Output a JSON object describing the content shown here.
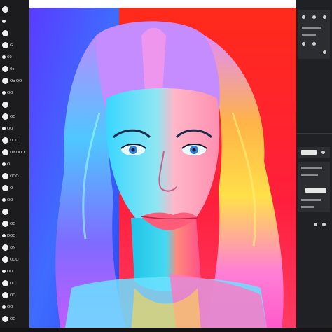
{
  "app": {
    "accent_color": "#f1f1f1",
    "toolbar_color": "#1c1c1e",
    "panel_color": "#202124"
  },
  "toolbar": {
    "tools": [
      {
        "icon": "brush-icon",
        "label": ""
      },
      {
        "icon": "eraser-icon",
        "label": ""
      },
      {
        "icon": "smudge-icon",
        "label": ""
      },
      {
        "icon": "blur-icon",
        "label": "G"
      },
      {
        "icon": "fill-icon",
        "label": "60"
      },
      {
        "icon": "select-icon",
        "label": "0o"
      },
      {
        "icon": "transform-icon",
        "label": "Oo OO"
      },
      {
        "icon": "text-icon",
        "label": "OO"
      },
      {
        "icon": "color-icon",
        "label": ""
      },
      {
        "icon": "layers-icon",
        "label": "OO"
      },
      {
        "icon": "adjust-icon",
        "label": "OO"
      },
      {
        "icon": "filter-icon",
        "label": "DOO"
      },
      {
        "icon": "shape-icon",
        "label": "De DOO"
      },
      {
        "icon": "gradient-icon",
        "label": "O"
      },
      {
        "icon": "pen-icon",
        "label": "OOO"
      },
      {
        "icon": "clone-icon",
        "label": "O"
      },
      {
        "icon": "heal-icon",
        "label": "OO"
      },
      {
        "icon": "liquify-icon",
        "label": ""
      },
      {
        "icon": "crop-icon",
        "label": "OO"
      },
      {
        "icon": "mask-icon",
        "label": "DOO"
      },
      {
        "icon": "warp-icon",
        "label": "ON"
      },
      {
        "icon": "mirror-icon",
        "label": "OOO"
      },
      {
        "icon": "grid-icon",
        "label": "OO"
      },
      {
        "icon": "ruler-icon",
        "label": "OO"
      },
      {
        "icon": "eyedropper-icon",
        "label": "OO"
      },
      {
        "icon": "hand-icon",
        "label": "OO"
      },
      {
        "icon": "zoom-icon",
        "label": "OO"
      }
    ]
  },
  "canvas": {
    "image_name": "neon-portrait-illustration"
  },
  "right_panel": {
    "sections": [
      {
        "name": "brush-settings"
      },
      {
        "name": "layer-properties"
      },
      {
        "name": "adjustments"
      }
    ]
  }
}
